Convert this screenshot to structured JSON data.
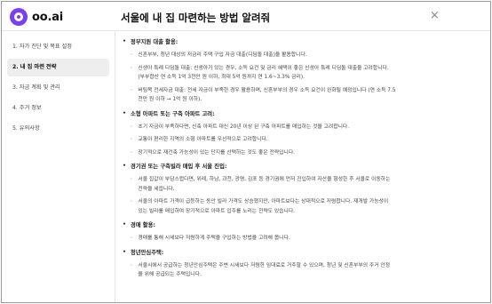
{
  "header": {
    "logo_text": "oo.ai",
    "title": "서울에 내 집 마련하는 방법 알려줘",
    "close_symbol": "×"
  },
  "sidebar": {
    "items": [
      {
        "label": "1. 자가 진단 및 목표 설정",
        "active": false
      },
      {
        "label": "2. 내 집 마련 전략",
        "active": true
      },
      {
        "label": "3. 자금 계획 및 관리",
        "active": false
      },
      {
        "label": "4. 주거 정보",
        "active": false
      },
      {
        "label": "5. 유의사항",
        "active": false
      }
    ]
  },
  "content": {
    "sections": [
      {
        "heading": "정부지원 대출 활용:",
        "bullets": [
          {
            "lines": [
              "신혼부부, 청년 대상의 저금리 주택 구입 자금 대출(디딤돌 대출)을 활용합니다."
            ]
          },
          {
            "lines": [
              "신생아 특례 디딤돌 대출: 신생아가 있는 경우, 소득 요건 및 금리 혜택이 좋은 신생아 특례 디딤돌 대출을 고려합니다.",
              "(부부합산 연 소득 1억 3천만 원 이하, 최대 5억 원까지 연 1.6~3.3% 금리)."
            ]
          },
          {
            "lines": [
              "버팀목 전세자금 대출: 전세 자금이 부족한 경우 활용하며, 신혼부부의 경우 소득 요건이 완화될 예정입니다 (연 소득 7.5",
              "천만 원 이하 → 1억 원 이하)."
            ]
          }
        ]
      },
      {
        "heading": "소형 아파트 또는 구축 아파트 고려:",
        "bullets": [
          {
            "lines": [
              "초기 자금이 부족하다면, 신축 아파트 대신 20년 이상 된 구축 아파트를 매입하는 것을 고려합니다."
            ]
          },
          {
            "lines": [
              "교통이 편리한 지역의 소형 아파트를 우선적으로 고려합니다."
            ]
          },
          {
            "lines": [
              "장기적으로 재건축 가능성이 있는 단지를 선택하는 것도 좋은 전략입니다."
            ]
          }
        ]
      },
      {
        "heading": "경기권 또는 구축빌라 매입 후 서울 진입:",
        "bullets": [
          {
            "lines": [
              "서울 집값이 부담스럽다면, 위례, 하남, 과천, 광명, 김포 등 경기권에 먼저 진입하여 자산을 형성한 후 서울로 이동하는",
              "전략을 세웁니다."
            ]
          },
          {
            "lines": [
              "서울의 아파트 가격이 급등하는 동안 빌라 가격도 상승했지만, 아파트보다는 상대적으로 저렴합니다. 재개발 가능성이",
              "있는 빌라를 매입하여 장기적으로 아파트 입주를 노리는 전략도 있습니다."
            ]
          }
        ]
      },
      {
        "heading": "경매 활용:",
        "bullets": [
          {
            "lines": [
              "경매를 통해 시세보다 저렴하게 주택을 구입하는 방법을 고려해 봅니다."
            ]
          }
        ]
      },
      {
        "heading": "청년안심주택:",
        "bullets": [
          {
            "lines": [
              "서울시에서 공급하는 청년안심주택은 주변 시세보다 저렴한 임대료로 거주할 수 있으며, 청년 및 신혼부부의 주거 안정",
              "을 위해 공급되는 주택입니다."
            ]
          }
        ]
      }
    ]
  }
}
